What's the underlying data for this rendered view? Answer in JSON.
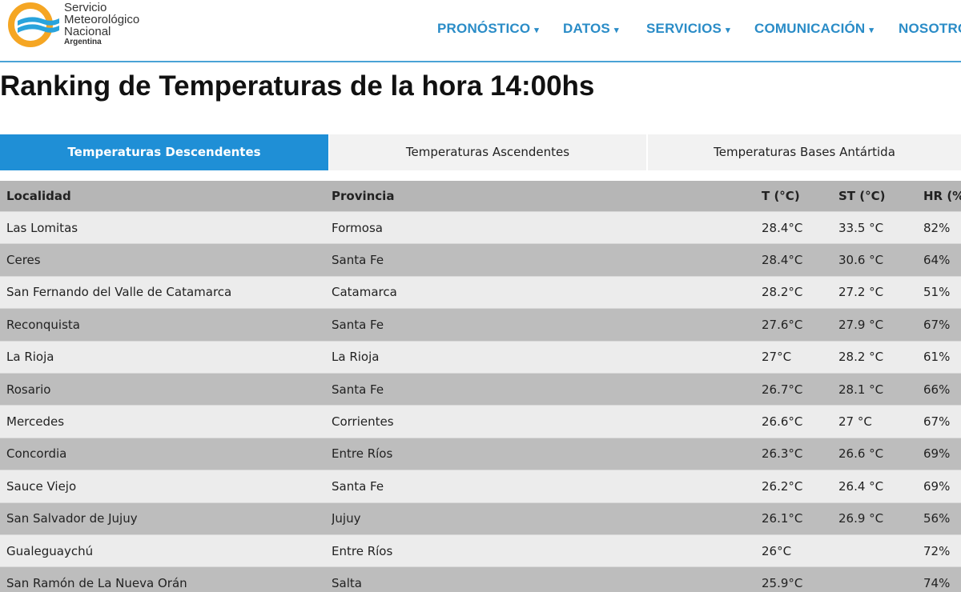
{
  "header": {
    "logo": {
      "line1": "Servicio",
      "line2": "Meteorológico",
      "line3": "Nacional",
      "country": "Argentina"
    },
    "nav": [
      {
        "label": "PRONÓSTICO",
        "icon": "chevron-down-icon"
      },
      {
        "label": "DATOS",
        "icon": "chevron-down-icon"
      },
      {
        "label": "SERVICIOS",
        "icon": "chevron-down-icon"
      },
      {
        "label": "COMUNICACIÓN",
        "icon": "chevron-down-icon"
      },
      {
        "label": "NOSOTRO"
      }
    ]
  },
  "title": "Ranking de Temperaturas de la hora 14:00hs",
  "tabs": [
    {
      "label": "Temperaturas Descendentes",
      "active": true
    },
    {
      "label": "Temperaturas Ascendentes",
      "active": false
    },
    {
      "label": "Temperaturas Bases Antártida",
      "active": false
    }
  ],
  "table": {
    "columns": [
      "Localidad",
      "Provincia",
      "T (°C)",
      "ST (°C)",
      "HR (%)"
    ],
    "rows": [
      [
        "Las Lomitas",
        "Formosa",
        "28.4°C",
        "33.5 °C",
        "82%"
      ],
      [
        "Ceres",
        "Santa Fe",
        "28.4°C",
        "30.6 °C",
        "64%"
      ],
      [
        "San Fernando del Valle de Catamarca",
        "Catamarca",
        "28.2°C",
        "27.2 °C",
        "51%"
      ],
      [
        "Reconquista",
        "Santa Fe",
        "27.6°C",
        "27.9 °C",
        "67%"
      ],
      [
        "La Rioja",
        "La Rioja",
        "27°C",
        "28.2 °C",
        "61%"
      ],
      [
        "Rosario",
        "Santa Fe",
        "26.7°C",
        "28.1 °C",
        "66%"
      ],
      [
        "Mercedes",
        "Corrientes",
        "26.6°C",
        "27 °C",
        "67%"
      ],
      [
        "Concordia",
        "Entre Ríos",
        "26.3°C",
        "26.6 °C",
        "69%"
      ],
      [
        "Sauce Viejo",
        "Santa Fe",
        "26.2°C",
        "26.4 °C",
        "69%"
      ],
      [
        "San Salvador de Jujuy",
        "Jujuy",
        "26.1°C",
        "26.9 °C",
        "56%"
      ],
      [
        "Gualeguaychú",
        "Entre Ríos",
        "26°C",
        "",
        "72%"
      ],
      [
        "San Ramón de La Nueva Orán",
        "Salta",
        "25.9°C",
        "",
        "74%"
      ]
    ]
  },
  "colors": {
    "accent": "#1f8fd6",
    "nav": "#2a8cc7",
    "logo_orange": "#f5a623",
    "logo_blue": "#29a3dc"
  }
}
